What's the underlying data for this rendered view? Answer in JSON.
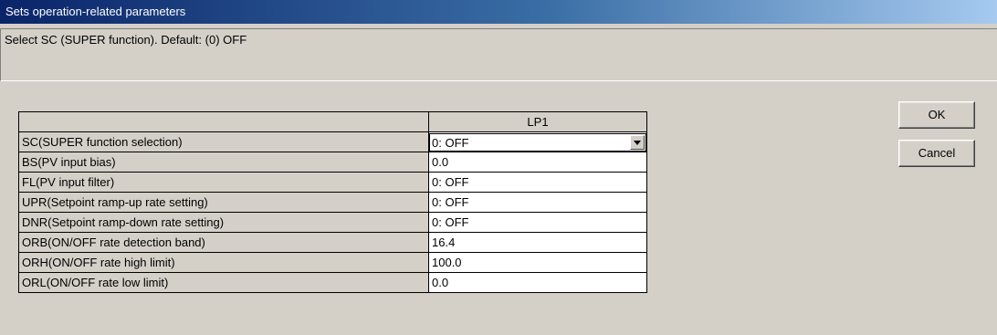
{
  "window": {
    "title": "Sets operation-related parameters"
  },
  "description": "Select SC (SUPER function).  Default: (0) OFF",
  "table": {
    "column_header": "LP1",
    "rows": [
      {
        "label": "SC(SUPER function selection)",
        "value": "0: OFF"
      },
      {
        "label": "BS(PV input bias)",
        "value": "0.0"
      },
      {
        "label": "FL(PV input filter)",
        "value": "0: OFF"
      },
      {
        "label": "UPR(Setpoint ramp-up rate setting)",
        "value": "0: OFF"
      },
      {
        "label": "DNR(Setpoint ramp-down rate setting)",
        "value": "0: OFF"
      },
      {
        "label": "ORB(ON/OFF rate detection band)",
        "value": "16.4"
      },
      {
        "label": "ORH(ON/OFF rate high limit)",
        "value": "100.0"
      },
      {
        "label": "ORL(ON/OFF rate low limit)",
        "value": "0.0"
      }
    ]
  },
  "buttons": {
    "ok": "OK",
    "cancel": "Cancel"
  },
  "icons": {
    "dropdown": "chevron-down-icon"
  }
}
